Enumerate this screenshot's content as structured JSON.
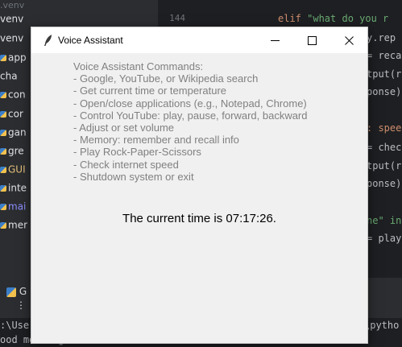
{
  "ide": {
    "project_top": ".venv",
    "project_items": [
      {
        "label": "venv",
        "type": "folder"
      },
      {
        "label": "app",
        "type": "py"
      },
      {
        "label": "cha",
        "type": "file"
      },
      {
        "label": "con",
        "type": "py"
      },
      {
        "label": "cor",
        "type": "py"
      },
      {
        "label": "gan",
        "type": "py"
      },
      {
        "label": "gre",
        "type": "py"
      },
      {
        "label": "GUI",
        "type": "py"
      },
      {
        "label": "inte",
        "type": "py"
      },
      {
        "label": "mai",
        "type": "py"
      },
      {
        "label": "mer",
        "type": "py"
      }
    ],
    "line_number": "144",
    "code_top_kw": "elif ",
    "code_top_str": "\"what do you r",
    "code_lines": [
      "y.rep",
      "= reca",
      "tput(r",
      "ponse)",
      "",
      ": spee",
      "= chec",
      "tput(r",
      "ponse)",
      "",
      "ne\" in",
      "= play"
    ],
    "run_tab": "G",
    "run_more": "⋮",
    "console_line1_left": ":\\Use",
    "console_line1_right": "\\pytho",
    "console_line2": "ood morning!"
  },
  "window": {
    "title": "Voice Assistant",
    "icon": "feather-icon",
    "minimize_glyph": "—",
    "maximize_glyph": "☐",
    "close_glyph": "✕",
    "commands": [
      "Voice Assistant Commands:",
      "- Google, YouTube, or Wikipedia search",
      "- Get current time or temperature",
      "- Open/close applications (e.g., Notepad, Chrome)",
      "- Control YouTube: play, pause, forward, backward",
      "- Adjust or set volume",
      "- Memory: remember and recall info",
      "- Play Rock-Paper-Scissors",
      "- Check internet speed",
      "- Shutdown system or exit"
    ],
    "status": "The current time is 07:17:26."
  }
}
